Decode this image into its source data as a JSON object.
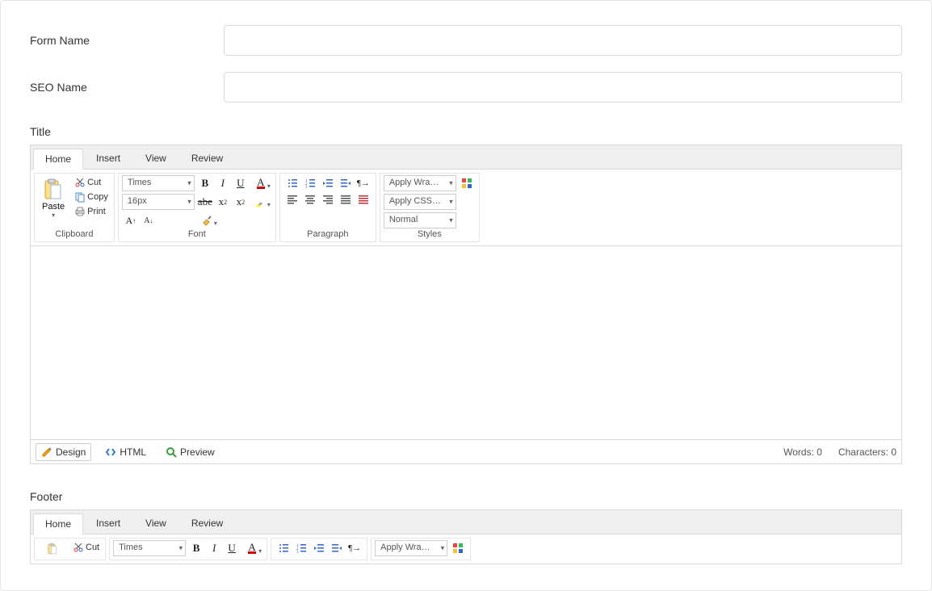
{
  "form": {
    "form_name_label": "Form Name",
    "form_name_value": "",
    "seo_name_label": "SEO Name",
    "seo_name_value": ""
  },
  "title_section_label": "Title",
  "footer_section_label": "Footer",
  "editor": {
    "tabs": [
      "Home",
      "Insert",
      "View",
      "Review"
    ],
    "active_tab": "Home",
    "groups": {
      "clipboard": {
        "title": "Clipboard",
        "paste": "Paste",
        "cut": "Cut",
        "copy": "Copy",
        "print": "Print"
      },
      "font": {
        "title": "Font",
        "family": "Times",
        "size": "16px"
      },
      "paragraph": {
        "title": "Paragraph"
      },
      "styles": {
        "title": "Styles",
        "wrapper": "Apply Wrapper",
        "css": "Apply CSS …",
        "block": "Normal"
      }
    },
    "modes": {
      "design": "Design",
      "html": "HTML",
      "preview": "Preview"
    },
    "stats": {
      "words_label": "Words:",
      "words_value": "0",
      "chars_label": "Characters:",
      "chars_value": "0"
    }
  }
}
